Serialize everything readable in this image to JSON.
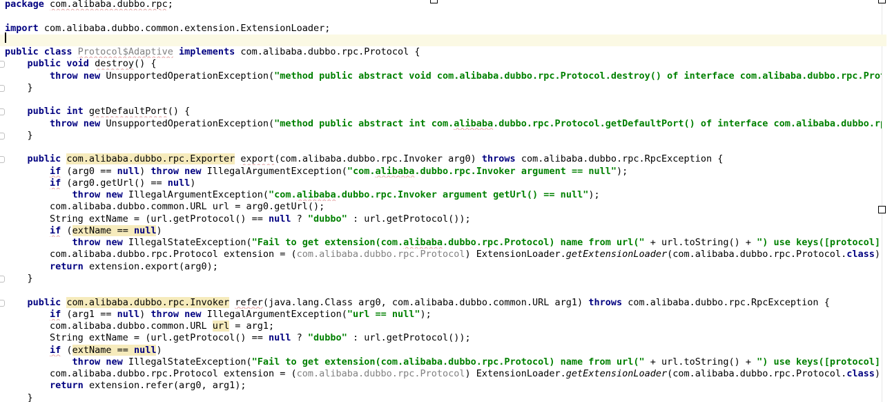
{
  "editor": {
    "lines": [
      {
        "tokens": [
          {
            "t": "package ",
            "s": "kw"
          },
          {
            "t": "com.alibaba.dubbo.rpc",
            "s": "squiggle"
          },
          {
            "t": ";",
            "s": "normal"
          }
        ]
      },
      {
        "tokens": []
      },
      {
        "tokens": [
          {
            "t": "import ",
            "s": "kw"
          },
          {
            "t": "com.alibaba.dubbo.common.extension.ExtensionLoader;",
            "s": "normal"
          }
        ]
      },
      {
        "current": true,
        "tokens": []
      },
      {
        "tokens": [
          {
            "t": "public class ",
            "s": "kw"
          },
          {
            "t": "Protocol$Adaptive",
            "s": "muted-squiggle"
          },
          {
            "t": " ",
            "s": "normal"
          },
          {
            "t": "implements ",
            "s": "kw"
          },
          {
            "t": "com.alibaba.dubbo.rpc.Protocol {",
            "s": "normal"
          }
        ]
      },
      {
        "tokens": [
          {
            "t": "    ",
            "s": "normal"
          },
          {
            "t": "public void ",
            "s": "kw"
          },
          {
            "t": "destroy",
            "s": "squiggle"
          },
          {
            "t": "() {",
            "s": "normal"
          }
        ]
      },
      {
        "tokens": [
          {
            "t": "        ",
            "s": "normal"
          },
          {
            "t": "throw new ",
            "s": "kw"
          },
          {
            "t": "UnsupportedOperationException(",
            "s": "normal"
          },
          {
            "t": "\"method public abstract void com.alibaba.dubbo.rpc.Protocol.destroy() of interface com.alibaba.dubbo.rpc.Proto",
            "s": "str"
          }
        ]
      },
      {
        "tokens": [
          {
            "t": "    }",
            "s": "normal"
          }
        ]
      },
      {
        "tokens": []
      },
      {
        "tokens": [
          {
            "t": "    ",
            "s": "normal"
          },
          {
            "t": "public int ",
            "s": "kw"
          },
          {
            "t": "getDefaultPort",
            "s": "squiggle"
          },
          {
            "t": "() {",
            "s": "normal"
          }
        ]
      },
      {
        "tokens": [
          {
            "t": "        ",
            "s": "normal"
          },
          {
            "t": "throw new ",
            "s": "kw"
          },
          {
            "t": "UnsupportedOperationException(",
            "s": "normal"
          },
          {
            "t": "\"method public abstract int com.",
            "s": "str"
          },
          {
            "t": "alibaba",
            "s": "str-squiggle"
          },
          {
            "t": ".dubbo.rpc.Protocol.getDefaultPort() of interface com.alibaba.dubbo.rpc",
            "s": "str"
          }
        ]
      },
      {
        "tokens": [
          {
            "t": "    }",
            "s": "normal"
          }
        ]
      },
      {
        "tokens": []
      },
      {
        "tokens": [
          {
            "t": "    ",
            "s": "normal"
          },
          {
            "t": "public ",
            "s": "kw"
          },
          {
            "t": "com.alibaba.dubbo.rpc.Exporter",
            "s": "hl"
          },
          {
            "t": " ",
            "s": "normal"
          },
          {
            "t": "export",
            "s": "squiggle"
          },
          {
            "t": "(com.alibaba.dubbo.rpc.Invoker arg0) ",
            "s": "normal"
          },
          {
            "t": "throws ",
            "s": "kw"
          },
          {
            "t": "com.alibaba.dubbo.rpc.RpcException {",
            "s": "normal"
          }
        ]
      },
      {
        "tokens": [
          {
            "t": "        ",
            "s": "normal"
          },
          {
            "t": "if",
            "s": "kw-squiggle"
          },
          {
            "t": " (arg0 == ",
            "s": "normal"
          },
          {
            "t": "null",
            "s": "kw"
          },
          {
            "t": ") ",
            "s": "normal"
          },
          {
            "t": "throw new ",
            "s": "kw"
          },
          {
            "t": "IllegalArgumentException(",
            "s": "normal"
          },
          {
            "t": "\"com.",
            "s": "str"
          },
          {
            "t": "alibaba",
            "s": "str-squiggle"
          },
          {
            "t": ".dubbo.rpc.Invoker argument == null\"",
            "s": "str"
          },
          {
            "t": ");",
            "s": "normal"
          }
        ]
      },
      {
        "tokens": [
          {
            "t": "        ",
            "s": "normal"
          },
          {
            "t": "if",
            "s": "kw-squiggle"
          },
          {
            "t": " (arg0.getUrl() == ",
            "s": "normal"
          },
          {
            "t": "null",
            "s": "kw"
          },
          {
            "t": ")",
            "s": "normal"
          }
        ]
      },
      {
        "tokens": [
          {
            "t": "            ",
            "s": "normal"
          },
          {
            "t": "throw new ",
            "s": "kw"
          },
          {
            "t": "IllegalArgumentException(",
            "s": "normal"
          },
          {
            "t": "\"com.",
            "s": "str"
          },
          {
            "t": "alibaba",
            "s": "str-squiggle"
          },
          {
            "t": ".dubbo.rpc.Invoker argument getUrl() == null\"",
            "s": "str"
          },
          {
            "t": ");",
            "s": "normal"
          }
        ]
      },
      {
        "tokens": [
          {
            "t": "        com.alibaba.dubbo.common.URL url = arg0.getUrl();",
            "s": "normal"
          }
        ]
      },
      {
        "tokens": [
          {
            "t": "        String extName = (url.getProtocol() == ",
            "s": "normal"
          },
          {
            "t": "null",
            "s": "kw"
          },
          {
            "t": " ? ",
            "s": "normal"
          },
          {
            "t": "\"dubbo\"",
            "s": "str"
          },
          {
            "t": " : url.getProtocol());",
            "s": "normal"
          }
        ]
      },
      {
        "tokens": [
          {
            "t": "        ",
            "s": "normal"
          },
          {
            "t": "if",
            "s": "kw-squiggle"
          },
          {
            "t": " (",
            "s": "normal"
          },
          {
            "t": "extName == ",
            "s": "hl"
          },
          {
            "t": "null",
            "s": "kw-hl"
          },
          {
            "t": ")",
            "s": "normal"
          }
        ]
      },
      {
        "tokens": [
          {
            "t": "            ",
            "s": "normal"
          },
          {
            "t": "throw new ",
            "s": "kw"
          },
          {
            "t": "IllegalStateException(",
            "s": "normal"
          },
          {
            "t": "\"Fail to get extension(com.",
            "s": "str"
          },
          {
            "t": "alibaba",
            "s": "str-squiggle"
          },
          {
            "t": ".dubbo.rpc.Protocol) name from url(\"",
            "s": "str"
          },
          {
            "t": " + url.toString() + ",
            "s": "normal"
          },
          {
            "t": "\") use keys([protocol])\"",
            "s": "str"
          }
        ]
      },
      {
        "tokens": [
          {
            "t": "        com.alibaba.dubbo.rpc.Protocol extension = (",
            "s": "normal"
          },
          {
            "t": "com.alibaba.dubbo.rpc.Protocol",
            "s": "muted"
          },
          {
            "t": ") ExtensionLoader.",
            "s": "normal"
          },
          {
            "t": "getExtensionLoader",
            "s": "italic"
          },
          {
            "t": "(com.alibaba.dubbo.rpc.Protocol.",
            "s": "normal"
          },
          {
            "t": "class",
            "s": "kw"
          },
          {
            "t": ").g",
            "s": "normal"
          }
        ]
      },
      {
        "tokens": [
          {
            "t": "        ",
            "s": "normal"
          },
          {
            "t": "return ",
            "s": "kw"
          },
          {
            "t": "extension.export(arg0);",
            "s": "normal"
          }
        ]
      },
      {
        "tokens": [
          {
            "t": "    }",
            "s": "normal"
          }
        ]
      },
      {
        "tokens": []
      },
      {
        "tokens": [
          {
            "t": "    ",
            "s": "normal"
          },
          {
            "t": "public ",
            "s": "kw"
          },
          {
            "t": "com.alibaba.dubbo.rpc.Invoker",
            "s": "hl"
          },
          {
            "t": " ",
            "s": "normal"
          },
          {
            "t": "refer",
            "s": "squiggle"
          },
          {
            "t": "(java.lang.Class arg0, com.alibaba.dubbo.common.URL arg1) ",
            "s": "normal"
          },
          {
            "t": "throws ",
            "s": "kw"
          },
          {
            "t": "com.alibaba.dubbo.rpc.RpcException {",
            "s": "normal"
          }
        ]
      },
      {
        "tokens": [
          {
            "t": "        ",
            "s": "normal"
          },
          {
            "t": "if",
            "s": "kw-squiggle"
          },
          {
            "t": " (arg1 == ",
            "s": "normal"
          },
          {
            "t": "null",
            "s": "kw"
          },
          {
            "t": ") ",
            "s": "normal"
          },
          {
            "t": "throw new ",
            "s": "kw"
          },
          {
            "t": "IllegalArgumentException(",
            "s": "normal"
          },
          {
            "t": "\"url == null\"",
            "s": "str"
          },
          {
            "t": ");",
            "s": "normal"
          }
        ]
      },
      {
        "tokens": [
          {
            "t": "        com.alibaba.dubbo.common.URL ",
            "s": "normal"
          },
          {
            "t": "url",
            "s": "hl"
          },
          {
            "t": " = arg1;",
            "s": "normal"
          }
        ]
      },
      {
        "tokens": [
          {
            "t": "        String extName = (url.getProtocol() == ",
            "s": "normal"
          },
          {
            "t": "null",
            "s": "kw"
          },
          {
            "t": " ? ",
            "s": "normal"
          },
          {
            "t": "\"dubbo\"",
            "s": "str"
          },
          {
            "t": " : url.getProtocol());",
            "s": "normal"
          }
        ]
      },
      {
        "tokens": [
          {
            "t": "        ",
            "s": "normal"
          },
          {
            "t": "if",
            "s": "kw-squiggle"
          },
          {
            "t": " (",
            "s": "normal"
          },
          {
            "t": "extName == ",
            "s": "hl"
          },
          {
            "t": "null",
            "s": "kw-hl"
          },
          {
            "t": ")",
            "s": "normal"
          }
        ]
      },
      {
        "tokens": [
          {
            "t": "            ",
            "s": "normal"
          },
          {
            "t": "throw new ",
            "s": "kw"
          },
          {
            "t": "IllegalStateException(",
            "s": "normal"
          },
          {
            "t": "\"Fail to get extension(com.alibaba.dubbo.rpc.Protocol) name from url(\"",
            "s": "str"
          },
          {
            "t": " + url.toString() + ",
            "s": "normal"
          },
          {
            "t": "\") use keys([protocol])\"",
            "s": "str"
          }
        ]
      },
      {
        "tokens": [
          {
            "t": "        com.alibaba.dubbo.rpc.Protocol extension = (",
            "s": "normal"
          },
          {
            "t": "com.alibaba.dubbo.rpc.Protocol",
            "s": "muted"
          },
          {
            "t": ") ExtensionLoader.",
            "s": "normal"
          },
          {
            "t": "getExtensionLoader",
            "s": "italic"
          },
          {
            "t": "(com.alibaba.dubbo.rpc.Protocol.",
            "s": "normal"
          },
          {
            "t": "class",
            "s": "kw"
          },
          {
            "t": ").g",
            "s": "normal"
          }
        ]
      },
      {
        "tokens": [
          {
            "t": "        ",
            "s": "normal"
          },
          {
            "t": "return ",
            "s": "kw"
          },
          {
            "t": "extension.refer(arg0, arg1);",
            "s": "normal"
          }
        ]
      },
      {
        "tokens": [
          {
            "t": "    }",
            "s": "normal"
          }
        ]
      }
    ]
  },
  "colors": {
    "keyword": "#000080",
    "string": "#008000",
    "muted": "#808080",
    "highlight": "#f6ebbc",
    "current_line": "#fbf9e4",
    "squiggle": "#e5a0a0"
  }
}
